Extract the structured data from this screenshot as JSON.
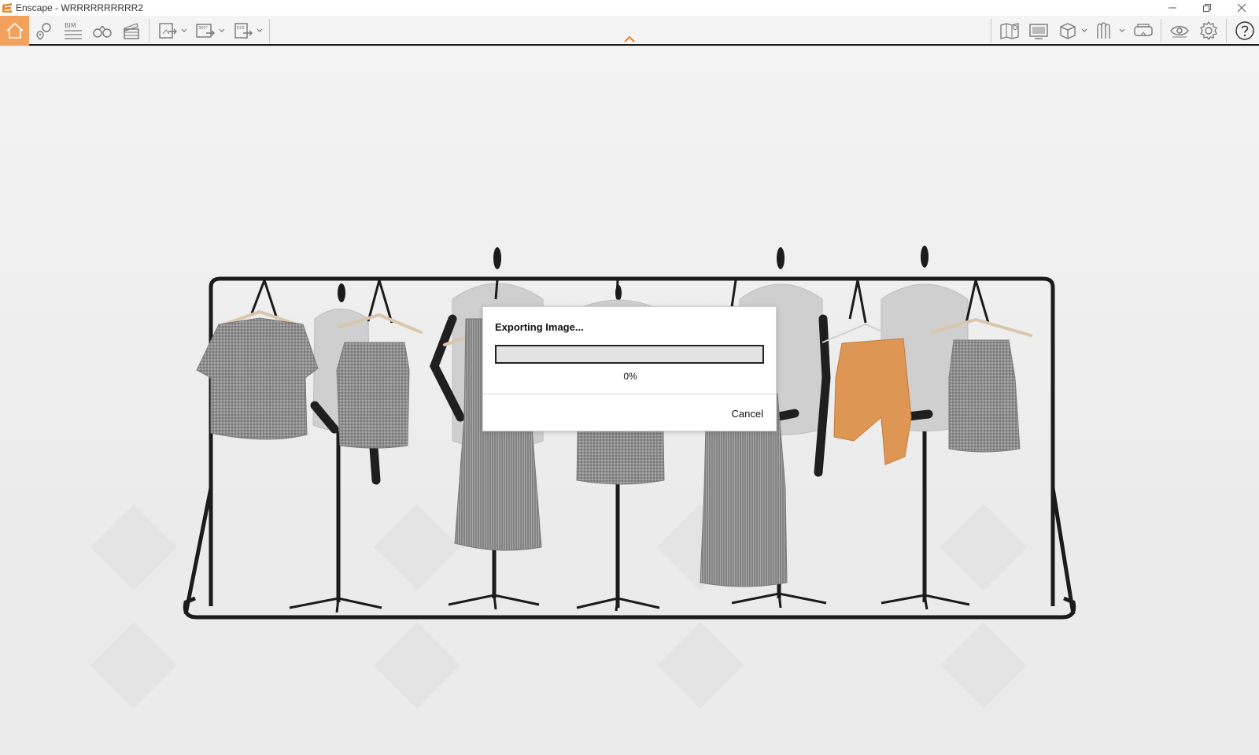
{
  "window": {
    "title": "Enscape - WRRRRRRRRRR2",
    "logo_icon": "enscape-logo-icon",
    "controls": [
      "minimize-icon",
      "restore-icon",
      "close-icon"
    ]
  },
  "toolbar": {
    "accent_color": "#f2a25c",
    "bim_label": "BIM",
    "panorama_label": "360°",
    "exe_label": "EXE",
    "left_tools": [
      {
        "name": "home-icon",
        "active": true
      },
      {
        "name": "map-pin-icon"
      },
      {
        "name": "bim-icon"
      },
      {
        "name": "binoculars-icon"
      },
      {
        "name": "video-clapper-icon"
      },
      {
        "name": "render-image-icon",
        "dropdown": true
      },
      {
        "name": "export-panorama-icon",
        "dropdown": true
      },
      {
        "name": "export-exe-icon",
        "dropdown": true
      }
    ],
    "right_tools": [
      {
        "name": "map-view-icon"
      },
      {
        "name": "monitor-icon"
      },
      {
        "name": "cube-view-icon",
        "dropdown": true
      },
      {
        "name": "asset-library-icon",
        "dropdown": true
      },
      {
        "name": "vr-headset-icon"
      },
      {
        "name": "visual-settings-eye-icon"
      },
      {
        "name": "settings-gear-icon"
      },
      {
        "name": "help-icon"
      }
    ]
  },
  "dialog": {
    "title": "Exporting Image...",
    "progress": 0,
    "progress_text": "0%",
    "cancel_label": "Cancel",
    "progress_color": "#f0a35a"
  }
}
